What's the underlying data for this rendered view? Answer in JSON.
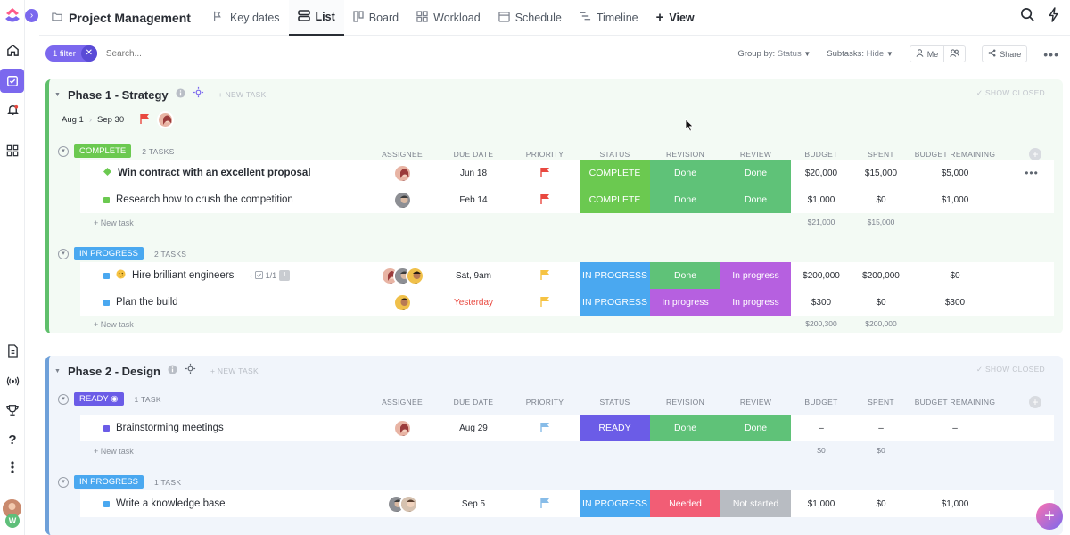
{
  "topbar": {
    "title": "Project Management",
    "tabs": [
      {
        "label": "Key dates",
        "icon": "key-dates-icon"
      },
      {
        "label": "List",
        "icon": "list-icon",
        "active": true
      },
      {
        "label": "Board",
        "icon": "board-icon"
      },
      {
        "label": "Workload",
        "icon": "workload-icon"
      },
      {
        "label": "Schedule",
        "icon": "schedule-icon"
      },
      {
        "label": "Timeline",
        "icon": "timeline-icon"
      }
    ],
    "add_view": "View"
  },
  "filterbar": {
    "filter_label": "1 filter",
    "search_placeholder": "Search...",
    "group_by_label": "Group by:",
    "group_by_value": "Status",
    "subtasks_label": "Subtasks:",
    "subtasks_value": "Hide",
    "me_label": "Me",
    "share_label": "Share"
  },
  "columns": [
    "ASSIGNEE",
    "DUE DATE",
    "PRIORITY",
    "STATUS",
    "REVISION",
    "REVIEW",
    "BUDGET",
    "SPENT",
    "BUDGET REMAINING"
  ],
  "colors": {
    "accent": "#7b68ee",
    "complete": "#6bc950",
    "in_progress": "#4aa8f0",
    "ready": "#6b5ce7",
    "done": "#5fc278",
    "purple": "#b660e0",
    "needed": "#f25d75",
    "not_started": "#b8bcc2",
    "flag_red": "#e9483f",
    "flag_yellow": "#f6c343",
    "flag_blue": "#87bce8"
  },
  "phase1": {
    "name": "Phase 1 - Strategy",
    "new_task": "+ NEW TASK",
    "show_closed": "SHOW CLOSED",
    "start": "Aug 1",
    "end": "Sep 30",
    "groups": [
      {
        "badge": "COMPLETE",
        "count": "2 TASKS",
        "tasks": [
          {
            "name": "Win contract with an excellent proposal",
            "due": "Jun 18",
            "status": "COMPLETE",
            "revision": "Done",
            "review": "Done",
            "budget": "$20,000",
            "spent": "$15,000",
            "remaining": "$5,000"
          },
          {
            "name": "Research how to crush the competition",
            "due": "Feb 14",
            "status": "COMPLETE",
            "revision": "Done",
            "review": "Done",
            "budget": "$1,000",
            "spent": "$0",
            "remaining": "$1,000"
          }
        ],
        "new_task": "+ New task",
        "sum_budget": "$21,000",
        "sum_spent": "$15,000"
      },
      {
        "badge": "IN PROGRESS",
        "count": "2 TASKS",
        "tasks": [
          {
            "name": "Hire brilliant engineers",
            "subtasks": "1/1",
            "tag": "1",
            "due": "Sat, 9am",
            "status": "IN PROGRESS",
            "revision": "Done",
            "review": "In progress",
            "budget": "$200,000",
            "spent": "$200,000",
            "remaining": "$0"
          },
          {
            "name": "Plan the build",
            "due": "Yesterday",
            "status": "IN PROGRESS",
            "revision": "In progress",
            "review": "In progress",
            "budget": "$300",
            "spent": "$0",
            "remaining": "$300"
          }
        ],
        "new_task": "+ New task",
        "sum_budget": "$200,300",
        "sum_spent": "$200,000"
      }
    ]
  },
  "phase2": {
    "name": "Phase 2 - Design",
    "new_task": "+ NEW TASK",
    "show_closed": "SHOW CLOSED",
    "groups": [
      {
        "badge": "READY",
        "count": "1 TASK",
        "tasks": [
          {
            "name": "Brainstorming meetings",
            "due": "Aug 29",
            "status": "READY",
            "revision": "Done",
            "review": "Done",
            "budget": "–",
            "spent": "–",
            "remaining": "–"
          }
        ],
        "new_task": "+ New task",
        "sum_budget": "$0",
        "sum_spent": "$0"
      },
      {
        "badge": "IN PROGRESS",
        "count": "1 TASK",
        "tasks": [
          {
            "name": "Write a knowledge base",
            "due": "Sep 5",
            "status": "IN PROGRESS",
            "revision": "Needed",
            "review": "Not started",
            "budget": "$1,000",
            "spent": "$0",
            "remaining": "$1,000"
          }
        ]
      }
    ]
  },
  "rail": {
    "workspace_initial": "W"
  }
}
